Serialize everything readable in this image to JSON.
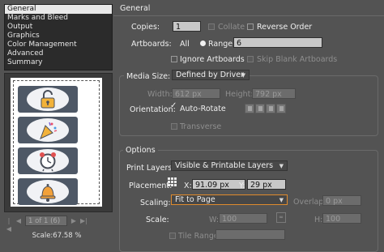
{
  "sidebar": {
    "categories": [
      {
        "label": "General",
        "selected": true
      },
      {
        "label": "Marks and Bleed",
        "selected": false
      },
      {
        "label": "Output",
        "selected": false
      },
      {
        "label": "Graphics",
        "selected": false
      },
      {
        "label": "Color Management",
        "selected": false
      },
      {
        "label": "Advanced",
        "selected": false
      },
      {
        "label": "Summary",
        "selected": false
      }
    ],
    "preview_icons": [
      "lock-icon",
      "party-popper-icon",
      "alarm-clock-icon",
      "bell-icon"
    ],
    "page_field": "1 of 1 (6)",
    "scale_text": "Scale:67.58 %"
  },
  "general": {
    "header": "General",
    "copies_label": "Copies:",
    "copies_value": "1",
    "collate_label": "Collate",
    "reverse_order_label": "Reverse Order",
    "artboards_label": "Artboards:",
    "all_label": "All",
    "range_label": "Range:",
    "range_value": "6",
    "ignore_artboards_label": "Ignore Artboards",
    "skip_blank_label": "Skip Blank Artboards"
  },
  "media": {
    "size_label": "Media Size:",
    "size_value": "Defined by Driver",
    "width_label": "Width:",
    "width_value": "612 px",
    "height_label": "Height:",
    "height_value": "792 px",
    "orientation_label": "Orientation:",
    "auto_rotate_label": "Auto-Rotate",
    "transverse_label": "Transverse"
  },
  "options": {
    "title": "Options",
    "print_layers_label": "Print Layers:",
    "print_layers_value": "Visible & Printable Layers",
    "placement_label": "Placement:",
    "x_label": "X:",
    "x_value": "91.09 px",
    "y_label": "Y:",
    "y_value": "29 px",
    "scaling_label": "Scaling:",
    "scaling_value": "Fit to Page",
    "overlap_label": "Overlap:",
    "overlap_value": "0 px",
    "scale_label": "Scale:",
    "w_label": "W:",
    "w_value": "100",
    "h_label": "H:",
    "h_value": "100",
    "tile_range_label": "Tile Range:"
  },
  "colors": {
    "background": "#535353",
    "panel_dark": "#2b2b2b",
    "focus_ring": "#e08b2d",
    "preview_card": "#4e5866"
  }
}
